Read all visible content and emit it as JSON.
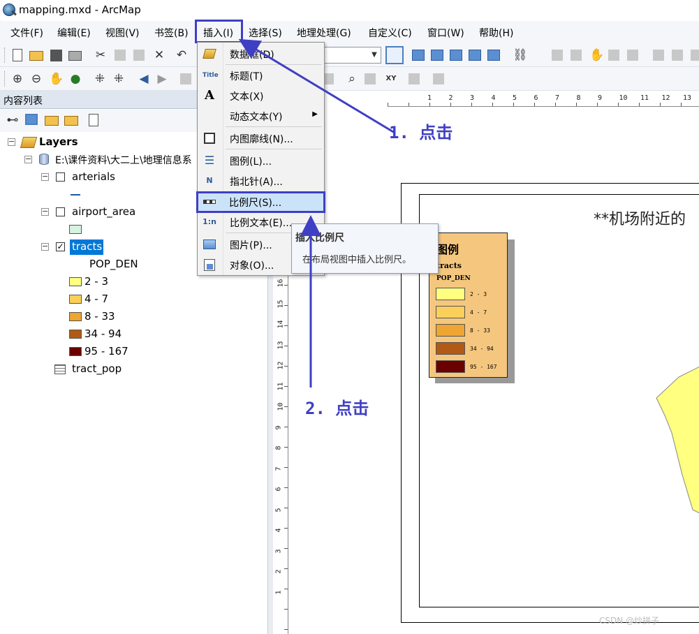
{
  "window": {
    "title": "mapping.mxd - ArcMap"
  },
  "menubar": {
    "items": [
      "文件(F)",
      "编辑(E)",
      "视图(V)",
      "书签(B)",
      "插入(I)",
      "选择(S)",
      "地理处理(G)",
      "自定义(C)",
      "窗口(W)",
      "帮助(H)"
    ]
  },
  "insert_menu": {
    "items": [
      {
        "label": "数据框(D)",
        "icon": "data-frame-icon"
      },
      {
        "label": "标题(T)",
        "icon": "title-icon",
        "icon_text": "Title"
      },
      {
        "label": "文本(X)",
        "icon": "text-icon",
        "icon_text": "A"
      },
      {
        "label": "动态文本(Y)",
        "icon": "dynamic-text-icon",
        "submenu": true
      },
      {
        "label": "内图廓线(N)...",
        "icon": "neatline-icon"
      },
      {
        "label": "图例(L)...",
        "icon": "legend-icon"
      },
      {
        "label": "指北针(A)...",
        "icon": "north-arrow-icon",
        "icon_text": "N"
      },
      {
        "label": "比例尺(S)...",
        "icon": "scale-bar-icon",
        "highlighted": true
      },
      {
        "label": "比例文本(E)...",
        "icon": "scale-text-icon",
        "icon_text": "1:n"
      },
      {
        "label": "图片(P)...",
        "icon": "picture-icon"
      },
      {
        "label": "对象(O)...",
        "icon": "object-icon"
      }
    ]
  },
  "tooltip": {
    "title": "插入比例尺",
    "description": "在布局视图中插入比例尺。"
  },
  "toc": {
    "title": "内容列表",
    "root": "Layers",
    "source": "E:\\课件资料\\大二上\\地理信息系",
    "layers": [
      {
        "name": "arterials",
        "checked": false
      },
      {
        "name": "airport_area",
        "checked": false
      },
      {
        "name": "tracts",
        "checked": true,
        "selected": true,
        "field": "POP_DEN",
        "classes": [
          {
            "label": "2 - 3",
            "color": "#ffff80"
          },
          {
            "label": "4 - 7",
            "color": "#fbd05a"
          },
          {
            "label": "8 - 33",
            "color": "#eea532"
          },
          {
            "label": "34 - 94",
            "color": "#b05a16"
          },
          {
            "label": "95 - 167",
            "color": "#6b0000"
          }
        ]
      }
    ],
    "table": "tract_pop"
  },
  "layout": {
    "map_title": "**机场附近的",
    "legend": {
      "title": "图例",
      "layer": "tracts",
      "field": "POP_DEN",
      "classes": [
        "2 - 3",
        "4 - 7",
        "8 - 33",
        "34 - 94",
        "95 - 167"
      ]
    },
    "ruler_top": [
      "1",
      "2",
      "3",
      "4",
      "5",
      "6",
      "7",
      "8",
      "9",
      "10",
      "11",
      "12",
      "13"
    ],
    "ruler_left": [
      "16",
      "15",
      "14",
      "13",
      "12",
      "11",
      "10",
      "9",
      "8",
      "7",
      "6",
      "5",
      "4",
      "3",
      "2",
      "1"
    ]
  },
  "annotations": {
    "step1": "1. 点击",
    "step2": "2. 点击"
  },
  "colors": {
    "annotation": "#3f3fc4",
    "selection": "#0078d7",
    "legend_bg": "#f5c77e"
  },
  "watermark": "CSDN @炒拼子"
}
